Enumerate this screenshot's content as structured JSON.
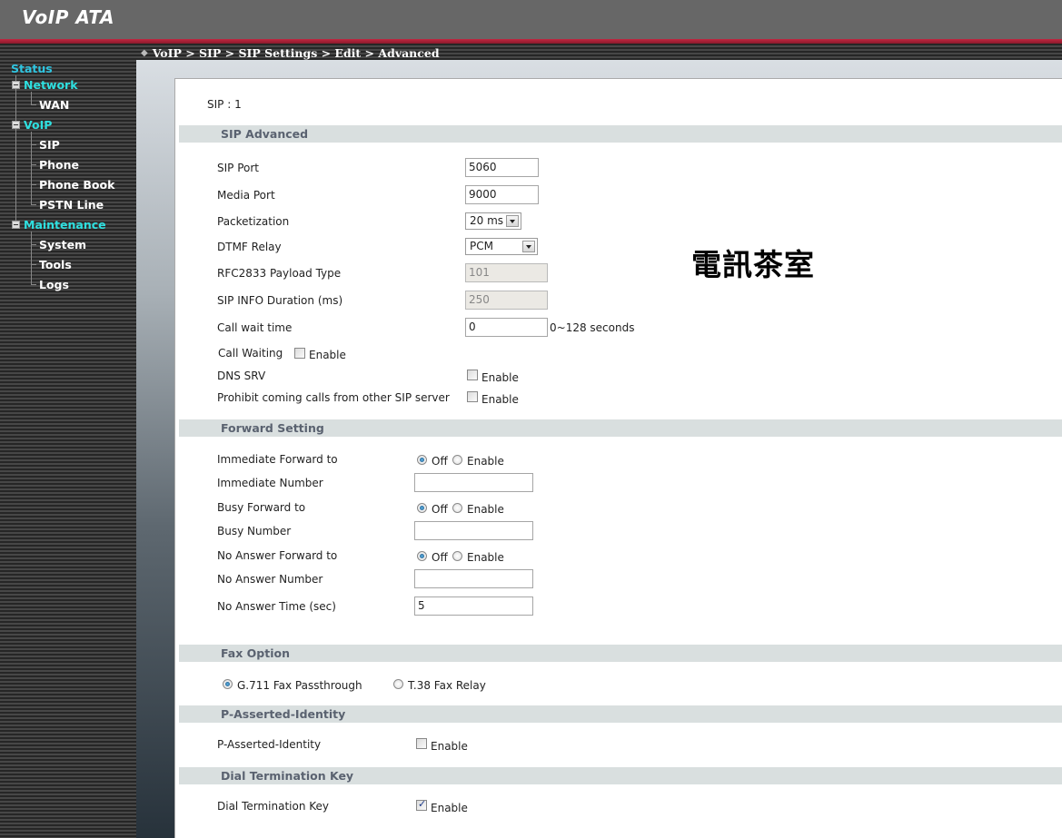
{
  "app": {
    "title": "VoIP ATA"
  },
  "breadcrumb": {
    "text": "VoIP > SIP > SIP Settings > Edit > Advanced"
  },
  "sidebar": {
    "status": "Status",
    "groups": [
      {
        "label": "Network",
        "items": [
          "WAN"
        ]
      },
      {
        "label": "VoIP",
        "items": [
          "SIP",
          "Phone",
          "Phone Book",
          "PSTN Line"
        ]
      },
      {
        "label": "Maintenance",
        "items": [
          "System",
          "Tools",
          "Logs"
        ]
      }
    ]
  },
  "page": {
    "sip_id": "SIP : 1",
    "watermark": "電訊茶室"
  },
  "sip_advanced": {
    "title": "SIP Advanced",
    "sip_port": {
      "label": "SIP Port",
      "value": "5060"
    },
    "media_port": {
      "label": "Media Port",
      "value": "9000"
    },
    "packetization": {
      "label": "Packetization",
      "value": "20 ms"
    },
    "dtmf_relay": {
      "label": "DTMF Relay",
      "value": "PCM"
    },
    "rfc2833": {
      "label": "RFC2833 Payload Type",
      "value": "101"
    },
    "sip_info": {
      "label": "SIP INFO Duration (ms)",
      "value": "250"
    },
    "call_wait_time": {
      "label": "Call wait time",
      "value": "0",
      "hint": "0~128 seconds"
    },
    "call_waiting": {
      "label": "Call Waiting",
      "option": "Enable",
      "checked": false
    },
    "dns_srv": {
      "label": "DNS SRV",
      "option": "Enable",
      "checked": false
    },
    "prohibit": {
      "label": "Prohibit coming calls from other SIP server",
      "option": "Enable",
      "checked": false
    }
  },
  "forward": {
    "title": "Forward Setting",
    "off_label": "Off",
    "enable_label": "Enable",
    "immediate_forward": {
      "label": "Immediate Forward to",
      "selected": "Off"
    },
    "immediate_number": {
      "label": "Immediate Number",
      "value": ""
    },
    "busy_forward": {
      "label": "Busy Forward to",
      "selected": "Off"
    },
    "busy_number": {
      "label": "Busy Number",
      "value": ""
    },
    "noanswer_forward": {
      "label": "No Answer Forward to",
      "selected": "Off"
    },
    "noanswer_number": {
      "label": "No Answer Number",
      "value": ""
    },
    "noanswer_time": {
      "label": "No Answer Time (sec)",
      "value": "5"
    }
  },
  "fax": {
    "title": "Fax Option",
    "g711": "G.711 Fax Passthrough",
    "t38": "T.38 Fax Relay",
    "selected": "G.711 Fax Passthrough"
  },
  "pai": {
    "title": "P-Asserted-Identity",
    "label": "P-Asserted-Identity",
    "option": "Enable",
    "checked": false
  },
  "dtk": {
    "title": "Dial Termination Key",
    "label": "Dial Termination Key",
    "option": "Enable",
    "checked": true
  }
}
